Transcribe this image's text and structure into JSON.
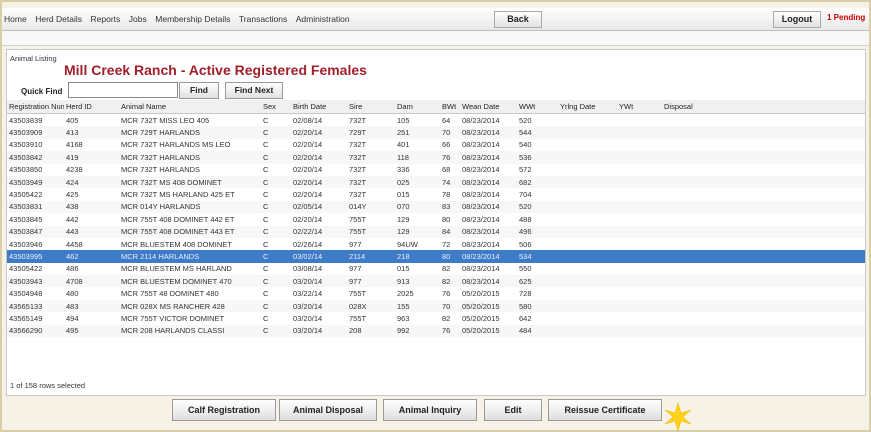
{
  "nav": {
    "items": [
      "Home",
      "Herd Details",
      "Reports",
      "Jobs",
      "Membership Details",
      "Transactions",
      "Administration"
    ],
    "back_label": "Back",
    "logout_label": "Logout",
    "pending_label": "1 Pending"
  },
  "page": {
    "breadcrumb": "Animal Listing",
    "title": "Mill Creek Ranch - Active Registered Females"
  },
  "search": {
    "label": "Quick Find",
    "value": "",
    "find_label": "Find",
    "find_next_label": "Find Next"
  },
  "table": {
    "columns": [
      "Registration Num",
      "Herd ID",
      "Animal Name",
      "Sex",
      "Birth Date",
      "Sire",
      "Dam",
      "BWt",
      "Wean Date",
      "WWt",
      "Yrlng Date",
      "YWt",
      "Disposal"
    ],
    "rows": [
      [
        "43503839",
        "405",
        "MCR 732T MISS LEO 405",
        "C",
        "02/08/14",
        "732T",
        "105",
        "64",
        "08/23/2014",
        "520",
        "",
        "",
        ""
      ],
      [
        "43503909",
        "413",
        "MCR 729T HARLANDS",
        "C",
        "02/20/14",
        "729T",
        "251",
        "70",
        "08/23/2014",
        "544",
        "",
        "",
        ""
      ],
      [
        "43503910",
        "4168",
        "MCR 732T HARLANDS MS LEO",
        "C",
        "02/20/14",
        "732T",
        "401",
        "66",
        "08/23/2014",
        "540",
        "",
        "",
        ""
      ],
      [
        "43503842",
        "419",
        "MCR 732T HARLANDS",
        "C",
        "02/20/14",
        "732T",
        "118",
        "76",
        "08/23/2014",
        "536",
        "",
        "",
        ""
      ],
      [
        "43503850",
        "4238",
        "MCR 732T HARLANDS",
        "C",
        "02/20/14",
        "732T",
        "336",
        "68",
        "08/23/2014",
        "572",
        "",
        "",
        ""
      ],
      [
        "43503949",
        "424",
        "MCR 732T MS 408 DOMINET",
        "C",
        "02/20/14",
        "732T",
        "025",
        "74",
        "08/23/2014",
        "682",
        "",
        "",
        ""
      ],
      [
        "43505422",
        "425",
        "MCR 732T MS HARLAND 425 ET",
        "C",
        "02/20/14",
        "732T",
        "015",
        "78",
        "08/23/2014",
        "704",
        "",
        "",
        ""
      ],
      [
        "43503831",
        "438",
        "MCR 014Y HARLANDS",
        "C",
        "02/05/14",
        "014Y",
        "070",
        "83",
        "08/23/2014",
        "520",
        "",
        "",
        ""
      ],
      [
        "43503845",
        "442",
        "MCR 755T 408 DOMINET 442 ET",
        "C",
        "02/20/14",
        "755T",
        "129",
        "80",
        "08/23/2014",
        "488",
        "",
        "",
        ""
      ],
      [
        "43503847",
        "443",
        "MCR 755T 408 DOMINET 443 ET",
        "C",
        "02/22/14",
        "755T",
        "129",
        "84",
        "08/23/2014",
        "496",
        "",
        "",
        ""
      ],
      [
        "43503946",
        "4458",
        "MCR BLUESTEM 408 DOMINET",
        "C",
        "02/26/14",
        "977",
        "94UW",
        "72",
        "08/23/2014",
        "506",
        "",
        "",
        ""
      ],
      [
        "43503995",
        "462",
        "MCR 2114 HARLANDS",
        "C",
        "03/02/14",
        "2114",
        "218",
        "80",
        "08/23/2014",
        "534",
        "",
        "",
        ""
      ],
      [
        "43505422",
        "486",
        "MCR BLUESTEM MS HARLAND",
        "C",
        "03/08/14",
        "977",
        "015",
        "82",
        "08/23/2014",
        "550",
        "",
        "",
        ""
      ],
      [
        "43503943",
        "4708",
        "MCR BLUESTEM DOMINET 470",
        "C",
        "03/20/14",
        "977",
        "913",
        "82",
        "08/23/2014",
        "625",
        "",
        "",
        ""
      ],
      [
        "43504948",
        "480",
        "MCR 755T 48 DOMINET 480",
        "C",
        "03/22/14",
        "755T",
        "2025",
        "76",
        "05/20/2015",
        "728",
        "",
        "",
        ""
      ],
      [
        "43565133",
        "483",
        "MCR 028X MS RANCHER 428",
        "C",
        "03/20/14",
        "028X",
        "155",
        "70",
        "05/20/2015",
        "580",
        "",
        "",
        ""
      ],
      [
        "43565149",
        "494",
        "MCR 755T VICTOR DOMINET",
        "C",
        "03/20/14",
        "755T",
        "963",
        "82",
        "05/20/2015",
        "642",
        "",
        "",
        ""
      ],
      [
        "43566290",
        "495",
        "MCR 208 HARLANDS CLASSI",
        "C",
        "03/20/14",
        "208",
        "992",
        "76",
        "05/20/2015",
        "484",
        "",
        "",
        ""
      ]
    ],
    "selected_index": 11,
    "footer": "1 of 158 rows selected"
  },
  "actions": {
    "calf_registration": "Calf Registration",
    "animal_disposal": "Animal Disposal",
    "animal_inquiry": "Animal Inquiry",
    "edit": "Edit",
    "reissue_certificate": "Reissue Certificate"
  },
  "colors": {
    "title": "#a01f2b",
    "selected_row": "#3e7cc8",
    "pending": "#d00000",
    "highlight_star": "#ffd21a"
  }
}
